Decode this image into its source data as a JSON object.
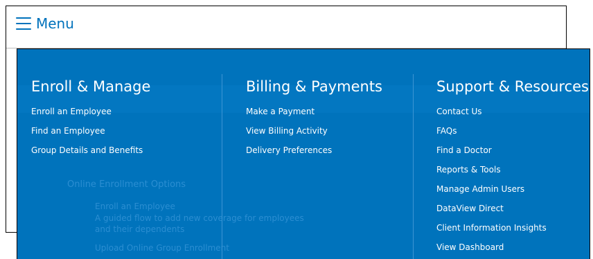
{
  "header": {
    "menu_label": "Menu"
  },
  "mega_menu": {
    "columns": [
      {
        "title": "Enroll & Manage",
        "items": [
          {
            "label": "Enroll an Employee"
          },
          {
            "label": "Find an Employee"
          },
          {
            "label": "Group Details and Benefits"
          }
        ]
      },
      {
        "title": "Billing & Payments",
        "items": [
          {
            "label": "Make a Payment"
          },
          {
            "label": "View Billing Activity"
          },
          {
            "label": "Delivery Preferences"
          }
        ]
      },
      {
        "title": "Support & Resources",
        "items": [
          {
            "label": "Contact Us"
          },
          {
            "label": "FAQs"
          },
          {
            "label": "Find a Doctor"
          },
          {
            "label": "Reports & Tools"
          },
          {
            "label": "Manage Admin Users"
          },
          {
            "label": "DataView Direct"
          },
          {
            "label": "Client Information Insights"
          },
          {
            "label": "View Dashboard"
          }
        ]
      }
    ]
  },
  "background_page": {
    "online_enrollment_options": "Online Enrollment Options",
    "enroll_an_employee": "Enroll an Employee",
    "enroll_description": "A guided flow to add new coverage for employees and their dependents",
    "upload_link": "Upload Online Group Enrollment"
  },
  "colors": {
    "brand_blue": "#0072bc",
    "menu_background": "#0073bc",
    "menu_text": "#ffffff"
  },
  "icons": {
    "menu": "hamburger-icon"
  }
}
